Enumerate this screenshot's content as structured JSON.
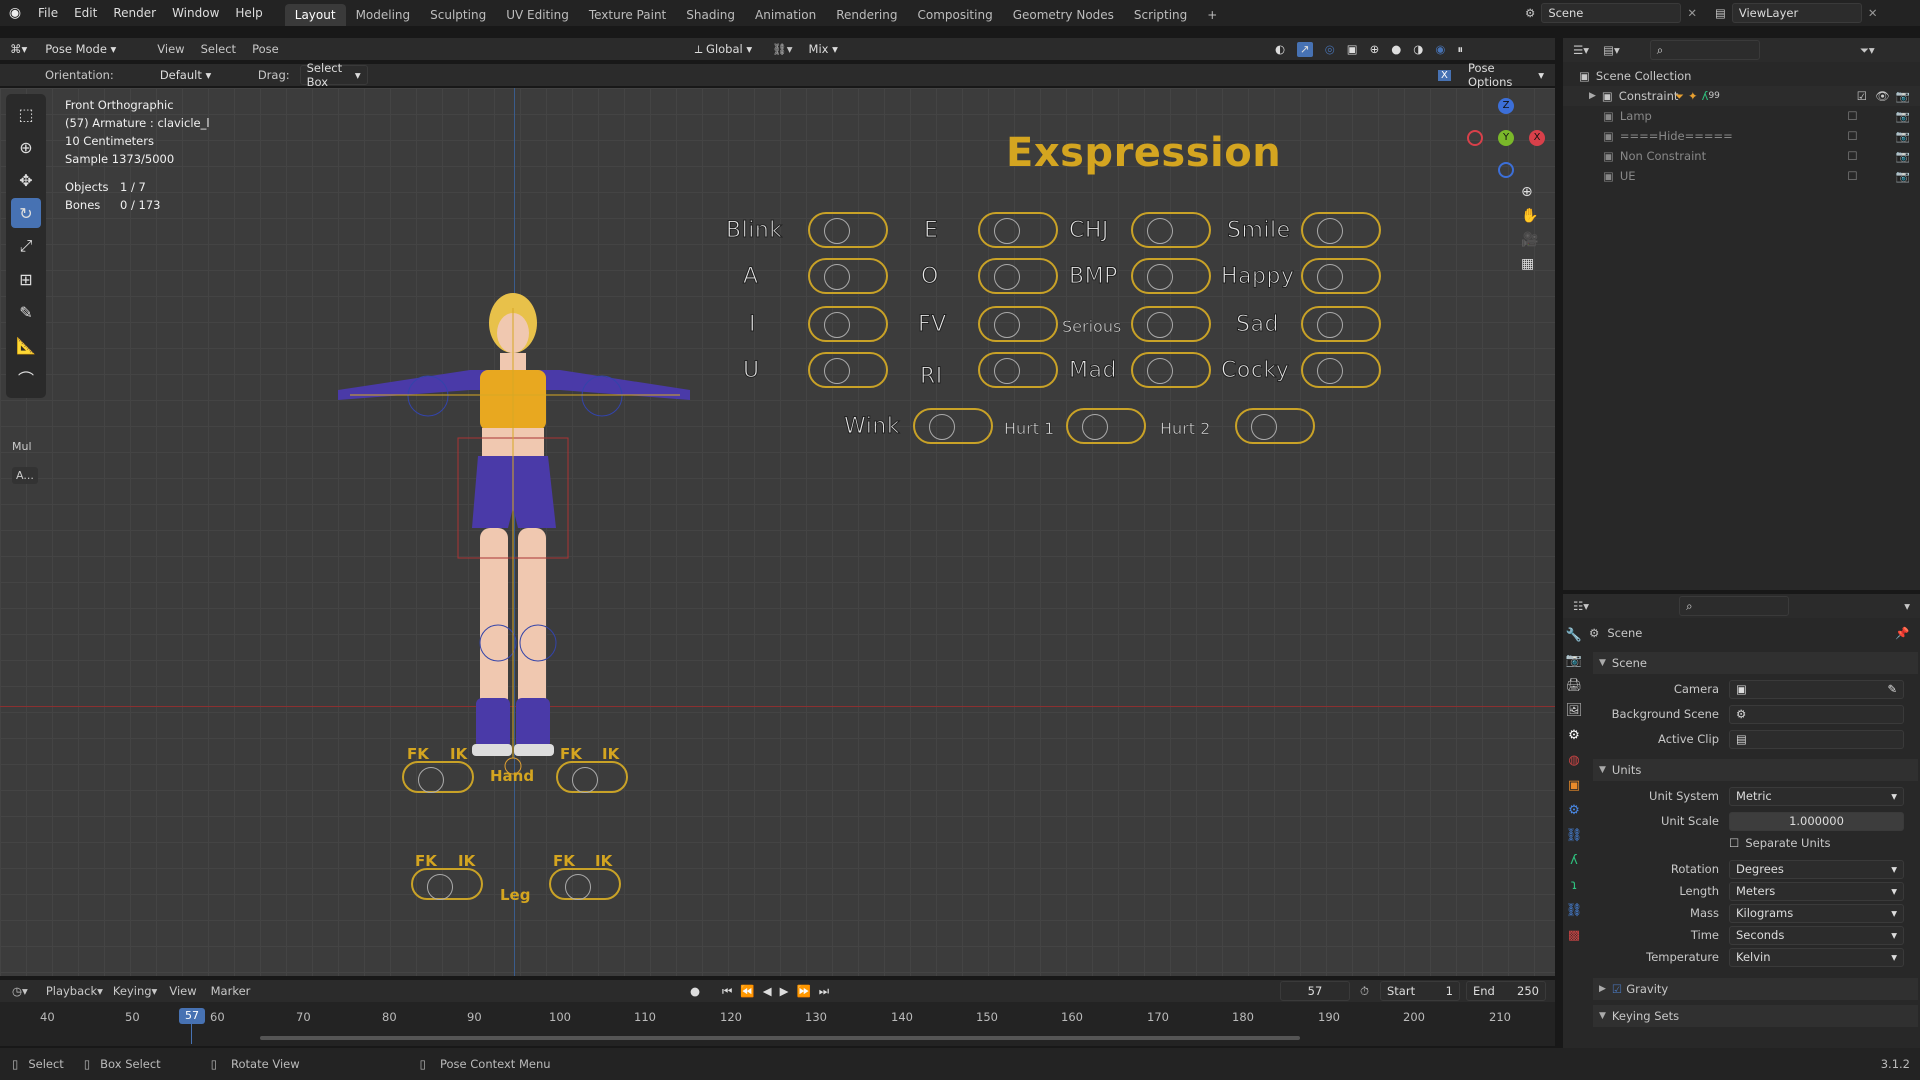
{
  "app": {
    "menus": [
      "File",
      "Edit",
      "Render",
      "Window",
      "Help"
    ],
    "workspaces": [
      "Layout",
      "Modeling",
      "Sculpting",
      "UV Editing",
      "Texture Paint",
      "Shading",
      "Animation",
      "Rendering",
      "Compositing",
      "Geometry Nodes",
      "Scripting"
    ],
    "active_workspace": "Layout",
    "scene": "Scene",
    "view_layer": "ViewLayer",
    "version": "3.1.2"
  },
  "header": {
    "mode": "Pose Mode",
    "view": "View",
    "select": "Select",
    "pose": "Pose",
    "transform": "Global",
    "pivot_mix": "Mix",
    "orientation_label": "Orientation:",
    "orientation": "Default",
    "drag_label": "Drag:",
    "drag": "Select Box",
    "pose_options": "Pose Options"
  },
  "viewport": {
    "info": [
      "Front Orthographic",
      "(57) Armature : clavicle_l",
      "10 Centimeters",
      "Sample 1373/5000"
    ],
    "objects_label": "Objects",
    "objects": "1 / 7",
    "bones_label": "Bones",
    "bones": "0 / 173",
    "title": "Exspression",
    "expressions": [
      "Blink",
      "E",
      "CHJ",
      "Smile",
      "A",
      "O",
      "BMP",
      "Happy",
      "I",
      "FV",
      "Serious",
      "Sad",
      "U",
      "RI",
      "Mad",
      "Cocky",
      "Wink",
      "Hurt 1",
      "Hurt 2"
    ],
    "fk": "FK",
    "ik": "IK",
    "hand": "Hand",
    "leg": "Leg",
    "axis_x": "X",
    "axis_y": "Y",
    "axis_z": "Z",
    "side_panel": [
      "Mul",
      "A..."
    ]
  },
  "outliner": {
    "root": "Scene Collection",
    "items": [
      "Constraint",
      "Lamp",
      "====Hide=====",
      "Non Constraint",
      "UE"
    ],
    "badge": "99"
  },
  "properties": {
    "context": "Scene",
    "section_scene": "Scene",
    "camera": "Camera",
    "background_scene": "Background Scene",
    "active_clip": "Active Clip",
    "section_units": "Units",
    "unit_system_label": "Unit System",
    "unit_system": "Metric",
    "unit_scale_label": "Unit Scale",
    "unit_scale": "1.000000",
    "separate_units": "Separate Units",
    "rotation_label": "Rotation",
    "rotation": "Degrees",
    "length_label": "Length",
    "length": "Meters",
    "mass_label": "Mass",
    "mass": "Kilograms",
    "time_label": "Time",
    "time": "Seconds",
    "temperature_label": "Temperature",
    "temperature": "Kelvin",
    "gravity": "Gravity",
    "keying_sets": "Keying Sets"
  },
  "timeline": {
    "playback": "Playback",
    "keying": "Keying",
    "view": "View",
    "marker": "Marker",
    "current_frame": "57",
    "start_label": "Start",
    "start": "1",
    "end_label": "End",
    "end": "250",
    "ticks": [
      "40",
      "50",
      "60",
      "70",
      "80",
      "90",
      "100",
      "110",
      "120",
      "130",
      "140",
      "150",
      "160",
      "170",
      "180",
      "190",
      "200",
      "210"
    ]
  },
  "statusbar": {
    "select": "Select",
    "box_select": "Box Select",
    "rotate_view": "Rotate View",
    "pose_context": "Pose Context Menu"
  },
  "colors": {
    "accent": "#4772b3",
    "gold": "#d4a520",
    "bg": "#3c3c3c"
  }
}
